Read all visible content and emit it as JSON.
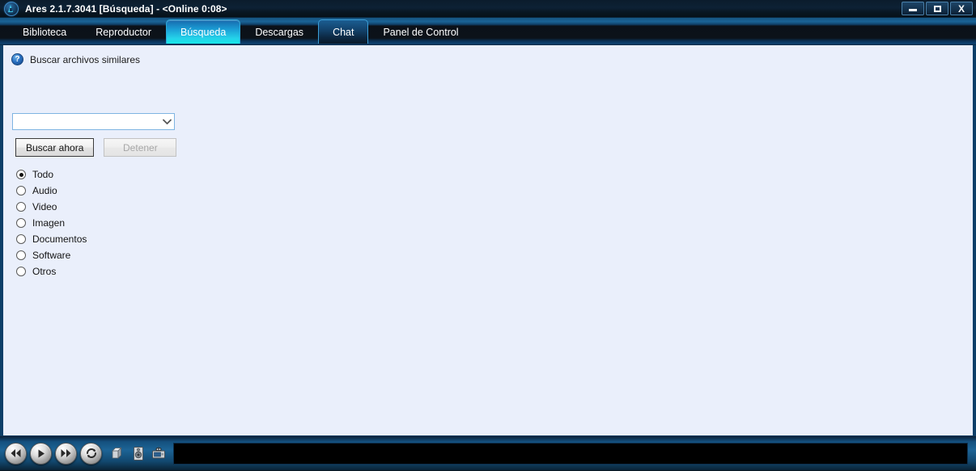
{
  "window": {
    "title": "Ares 2.1.7.3041   [Búsqueda]   -   <Online 0:08>",
    "buttons": {
      "minimize": "minimize-icon",
      "maximize": "maximize-icon",
      "close": "X"
    }
  },
  "nav": {
    "tabs": [
      {
        "label": "Biblioteca",
        "state": "normal"
      },
      {
        "label": "Reproductor",
        "state": "normal"
      },
      {
        "label": "Búsqueda",
        "state": "active"
      },
      {
        "label": "Descargas",
        "state": "normal"
      },
      {
        "label": "Chat",
        "state": "hover"
      },
      {
        "label": "Panel de Control",
        "state": "normal"
      }
    ]
  },
  "search": {
    "hint_icon": "help-icon",
    "hint_text": "Buscar archivos similares",
    "query_value": "",
    "query_placeholder": "",
    "dropdown_icon": "chevron-down-icon",
    "search_button": "Buscar ahora",
    "stop_button": "Detener",
    "stop_button_disabled": true,
    "filters": [
      {
        "label": "Todo",
        "checked": true
      },
      {
        "label": "Audio",
        "checked": false
      },
      {
        "label": "Video",
        "checked": false
      },
      {
        "label": "Imagen",
        "checked": false
      },
      {
        "label": "Documentos",
        "checked": false
      },
      {
        "label": "Software",
        "checked": false
      },
      {
        "label": "Otros",
        "checked": false
      }
    ]
  },
  "bottom": {
    "media_buttons": [
      {
        "name": "previous-icon",
        "label": "Anterior"
      },
      {
        "name": "play-icon",
        "label": "Reproducir"
      },
      {
        "name": "next-icon",
        "label": "Siguiente"
      },
      {
        "name": "repeat-icon",
        "label": "Repetir"
      }
    ],
    "tray_icons": [
      {
        "name": "package-icon",
        "label": "Biblioteca"
      },
      {
        "name": "speaker-icon",
        "label": "Volumen"
      },
      {
        "name": "robot-icon",
        "label": "Asistente"
      }
    ],
    "status_text": ""
  },
  "colors": {
    "accent_cyan": "#16e8e8",
    "accent_blue": "#1b9fd6",
    "chrome_dark": "#0c1219",
    "panel_bg": "#eaeffb",
    "frame_blue": "#0d3f68"
  }
}
